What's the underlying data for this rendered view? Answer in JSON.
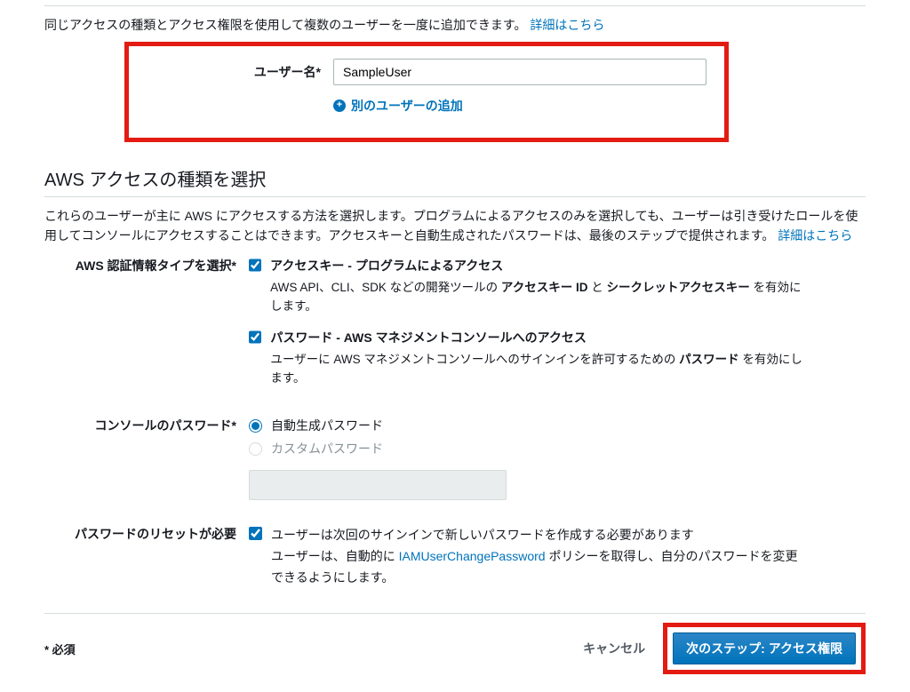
{
  "user_section": {
    "description_text": "同じアクセスの種類とアクセス権限を使用して複数のユーザーを一度に追加できます。",
    "details_link": "詳細はこちら",
    "username_label": "ユーザー名*",
    "username_value": "SampleUser",
    "add_another_label": "別のユーザーの追加"
  },
  "access_type": {
    "section_title": "AWS アクセスの種類を選択",
    "description_text": "これらのユーザーが主に AWS にアクセスする方法を選択します。プログラムによるアクセスのみを選択しても、ユーザーは引き受けたロールを使用してコンソールにアクセスすることはできます。アクセスキーと自動生成されたパスワードは、最後のステップで提供されます。",
    "details_link": "詳細はこちら",
    "cred_type_label": "AWS 認証情報タイプを選択*",
    "option1": {
      "title": "アクセスキー - プログラムによるアクセス",
      "desc_prefix": "AWS API、CLI、SDK などの開発ツールの ",
      "strong1": "アクセスキー ID",
      "mid": " と ",
      "strong2": "シークレットアクセスキー",
      "desc_suffix": " を有効にします。"
    },
    "option2": {
      "title": "パスワード - AWS マネジメントコンソールへのアクセス",
      "desc_prefix": "ユーザーに AWS マネジメントコンソールへのサインインを許可するための ",
      "strong": "パスワード",
      "desc_suffix": " を有効にします。"
    }
  },
  "console_pw": {
    "label": "コンソールのパスワード*",
    "auto_label": "自動生成パスワード",
    "custom_label": "カスタムパスワード"
  },
  "reset": {
    "label": "パスワードのリセットが必要",
    "line1": "ユーザーは次回のサインインで新しいパスワードを作成する必要があります",
    "line2_prefix": "ユーザーは、自動的に ",
    "policy_link": "IAMUserChangePassword",
    "line2_suffix": " ポリシーを取得し、自分のパスワードを変更できるようにします。"
  },
  "footer": {
    "required_text": "* 必須",
    "cancel_label": "キャンセル",
    "next_label": "次のステップ: アクセス権限"
  }
}
